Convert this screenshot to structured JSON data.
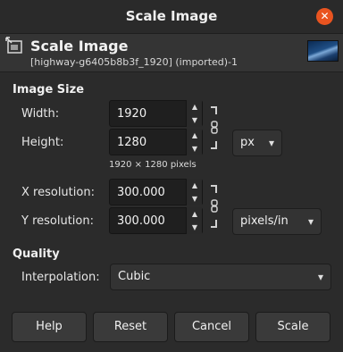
{
  "window": {
    "title": "Scale Image",
    "close_glyph": "✕"
  },
  "header": {
    "title": "Scale Image",
    "subtitle": "[highway-g6405b8b3f_1920] (imported)-1",
    "icon": "scale-image-icon",
    "thumbnail": "image-thumbnail"
  },
  "image_size": {
    "section_label": "Image Size",
    "width_label": "Width:",
    "width_value": "1920",
    "height_label": "Height:",
    "height_value": "1280",
    "size_note": "1920 × 1280 pixels",
    "unit_selected": "px",
    "chain_icon": "chain-link-icon"
  },
  "resolution": {
    "x_label": "X resolution:",
    "x_value": "300.000",
    "y_label": "Y resolution:",
    "y_value": "300.000",
    "unit_selected": "pixels/in"
  },
  "quality": {
    "section_label": "Quality",
    "interpolation_label": "Interpolation:",
    "interpolation_selected": "Cubic"
  },
  "buttons": {
    "help": "Help",
    "reset": "Reset",
    "cancel": "Cancel",
    "scale": "Scale"
  },
  "colors": {
    "background": "#2b2b2b",
    "close_button": "#e95420"
  }
}
